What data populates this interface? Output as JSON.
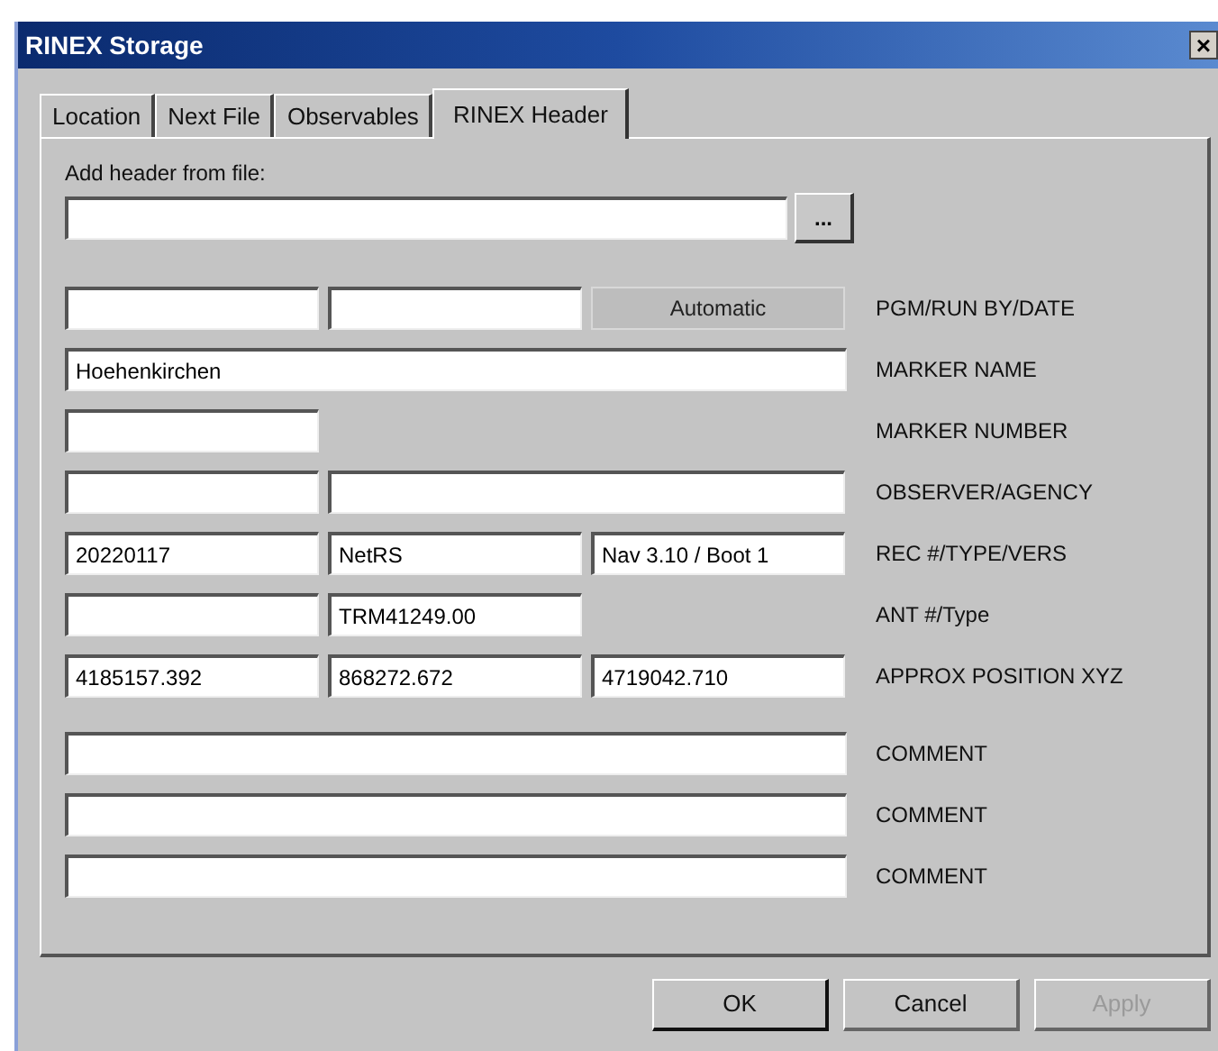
{
  "window": {
    "title": "RINEX Storage",
    "close": "×"
  },
  "tabs": [
    {
      "label": "Location",
      "selected": false
    },
    {
      "label": "Next File",
      "selected": false
    },
    {
      "label": "Observables",
      "selected": false
    },
    {
      "label": "RINEX Header",
      "selected": true
    }
  ],
  "file_picker": {
    "label": "Add header from file:",
    "browse": "..."
  },
  "rows": [
    {
      "label": "PGM/RUN BY/DATE",
      "cells": [
        {
          "kind": "field"
        },
        {
          "kind": "field"
        },
        {
          "kind": "static",
          "text": "Automatic"
        }
      ]
    },
    {
      "label": "MARKER NAME",
      "cells": [
        {
          "kind": "full",
          "value": "Hoehenkirchen"
        }
      ]
    },
    {
      "label": "MARKER NUMBER",
      "cells": [
        {
          "kind": "field"
        }
      ]
    },
    {
      "label": "OBSERVER/AGENCY",
      "cells": [
        {
          "kind": "field"
        },
        {
          "kind": "wide"
        }
      ]
    },
    {
      "label": "REC #/TYPE/VERS",
      "cells": [
        {
          "kind": "field",
          "value": "20220117"
        },
        {
          "kind": "field",
          "value": "NetRS"
        },
        {
          "kind": "field",
          "value": "Nav 3.10 / Boot 1"
        }
      ]
    },
    {
      "label": "ANT #/Type",
      "cells": [
        {
          "kind": "field"
        },
        {
          "kind": "field",
          "value": "TRM41249.00"
        }
      ]
    },
    {
      "label": "APPROX POSITION XYZ",
      "cells": [
        {
          "kind": "field",
          "value": "4185157.392"
        },
        {
          "kind": "field",
          "value": "868272.672"
        },
        {
          "kind": "field",
          "value": "4719042.710"
        }
      ]
    }
  ],
  "comments": [
    {
      "label": "COMMENT"
    },
    {
      "label": "COMMENT"
    },
    {
      "label": "COMMENT"
    }
  ],
  "buttons": [
    {
      "label": "OK",
      "disabled": false,
      "default": true
    },
    {
      "label": "Cancel",
      "disabled": false,
      "default": false
    },
    {
      "label": "Apply",
      "disabled": true,
      "default": false
    }
  ]
}
